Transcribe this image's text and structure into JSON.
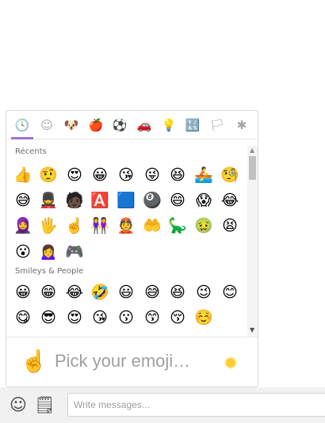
{
  "tabs": [
    {
      "icon": "clock-icon",
      "glyph": "🕓"
    },
    {
      "icon": "smiley-icon",
      "glyph": "☺"
    },
    {
      "icon": "animal-icon",
      "glyph": "🐶"
    },
    {
      "icon": "food-icon",
      "glyph": "🍎"
    },
    {
      "icon": "activity-icon",
      "glyph": "⚽"
    },
    {
      "icon": "car-icon",
      "glyph": "🚗"
    },
    {
      "icon": "lightbulb-icon",
      "glyph": "💡"
    },
    {
      "icon": "symbols-icon",
      "glyph": "🔣"
    },
    {
      "icon": "flag-icon",
      "glyph": "🏳"
    },
    {
      "icon": "asterisk-icon",
      "glyph": "✱"
    }
  ],
  "categories": {
    "recent": {
      "label": "Récents",
      "emojis": [
        "👍",
        "🤨",
        "😍",
        "😀",
        "😘",
        "😜",
        "😆",
        "🚣",
        "🧐",
        "😅",
        "💂",
        "🧑🏿",
        "🅰️",
        "🟦",
        "🎱",
        "😄",
        "😱",
        "😂",
        "🧕",
        "🖐",
        "☝️",
        "👭",
        "👲",
        "🤲",
        "🦕",
        "🤢",
        "😫",
        "😮",
        "🙍‍♀️",
        "🎮"
      ]
    },
    "smileys": {
      "label": "Smileys & People",
      "emojis": [
        "😀",
        "😁",
        "😂",
        "🤣",
        "😃",
        "😅",
        "😆",
        "😉",
        "😊",
        "😋",
        "😎",
        "😍",
        "😘",
        "😗",
        "😙",
        "😚",
        "☺️"
      ]
    }
  },
  "preview": {
    "emoji": "☝️",
    "text": "Pick your emoji…",
    "skin_tone_color": "#ffcc33"
  },
  "composer": {
    "emoji_button_glyph": "☺",
    "sticker_button_glyph": "🗒",
    "placeholder": "Write messages..."
  },
  "colors": {
    "accent": "#9a73d6",
    "tab_inactive": "#a5a5a5"
  }
}
